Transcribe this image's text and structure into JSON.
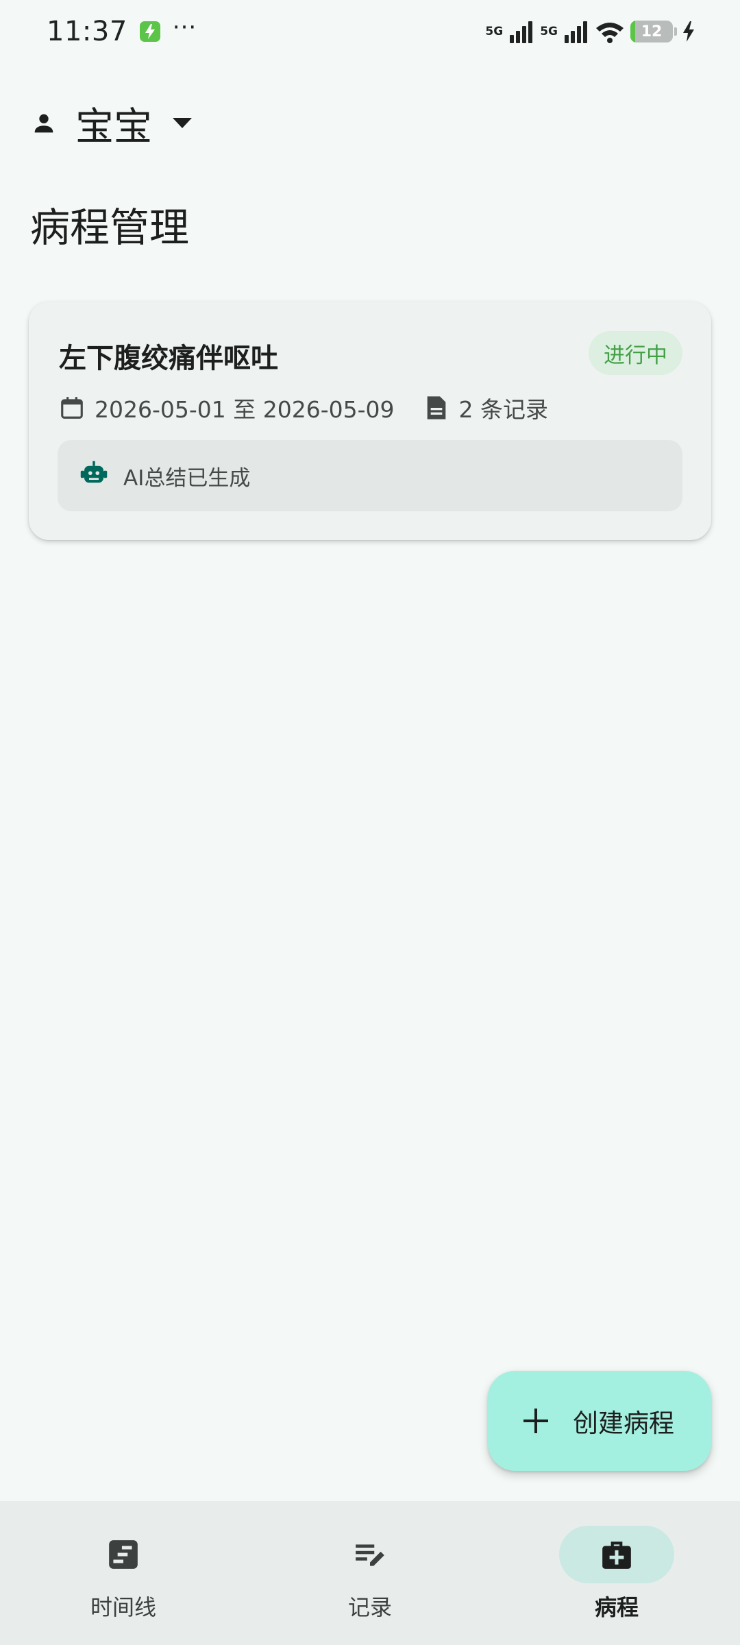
{
  "status_bar": {
    "time": "11:37",
    "more": "···",
    "network_1": "5G",
    "network_2": "5G",
    "battery_level": 12,
    "battery_text": "12",
    "battery_color": "#5dc44a"
  },
  "profile": {
    "name": "宝宝"
  },
  "page": {
    "title": "病程管理"
  },
  "courses": [
    {
      "title": "左下腹绞痛伴呕吐",
      "status": "进行中",
      "date_range": "2026-05-01 至 2026-05-09",
      "record_count": "2 条记录",
      "ai_summary": "AI总结已生成"
    }
  ],
  "fab": {
    "label": "创建病程"
  },
  "bottom_nav": {
    "items": [
      {
        "label": "时间线",
        "icon": "timeline-icon",
        "active": false
      },
      {
        "label": "记录",
        "icon": "edit-note-icon",
        "active": false
      },
      {
        "label": "病程",
        "icon": "medical-bag-icon",
        "active": true
      }
    ]
  },
  "colors": {
    "background": "#f4f9f7",
    "accent": "#a3efe0",
    "status_green": "#43a047",
    "active_nav_pill": "#cbe9e3"
  }
}
